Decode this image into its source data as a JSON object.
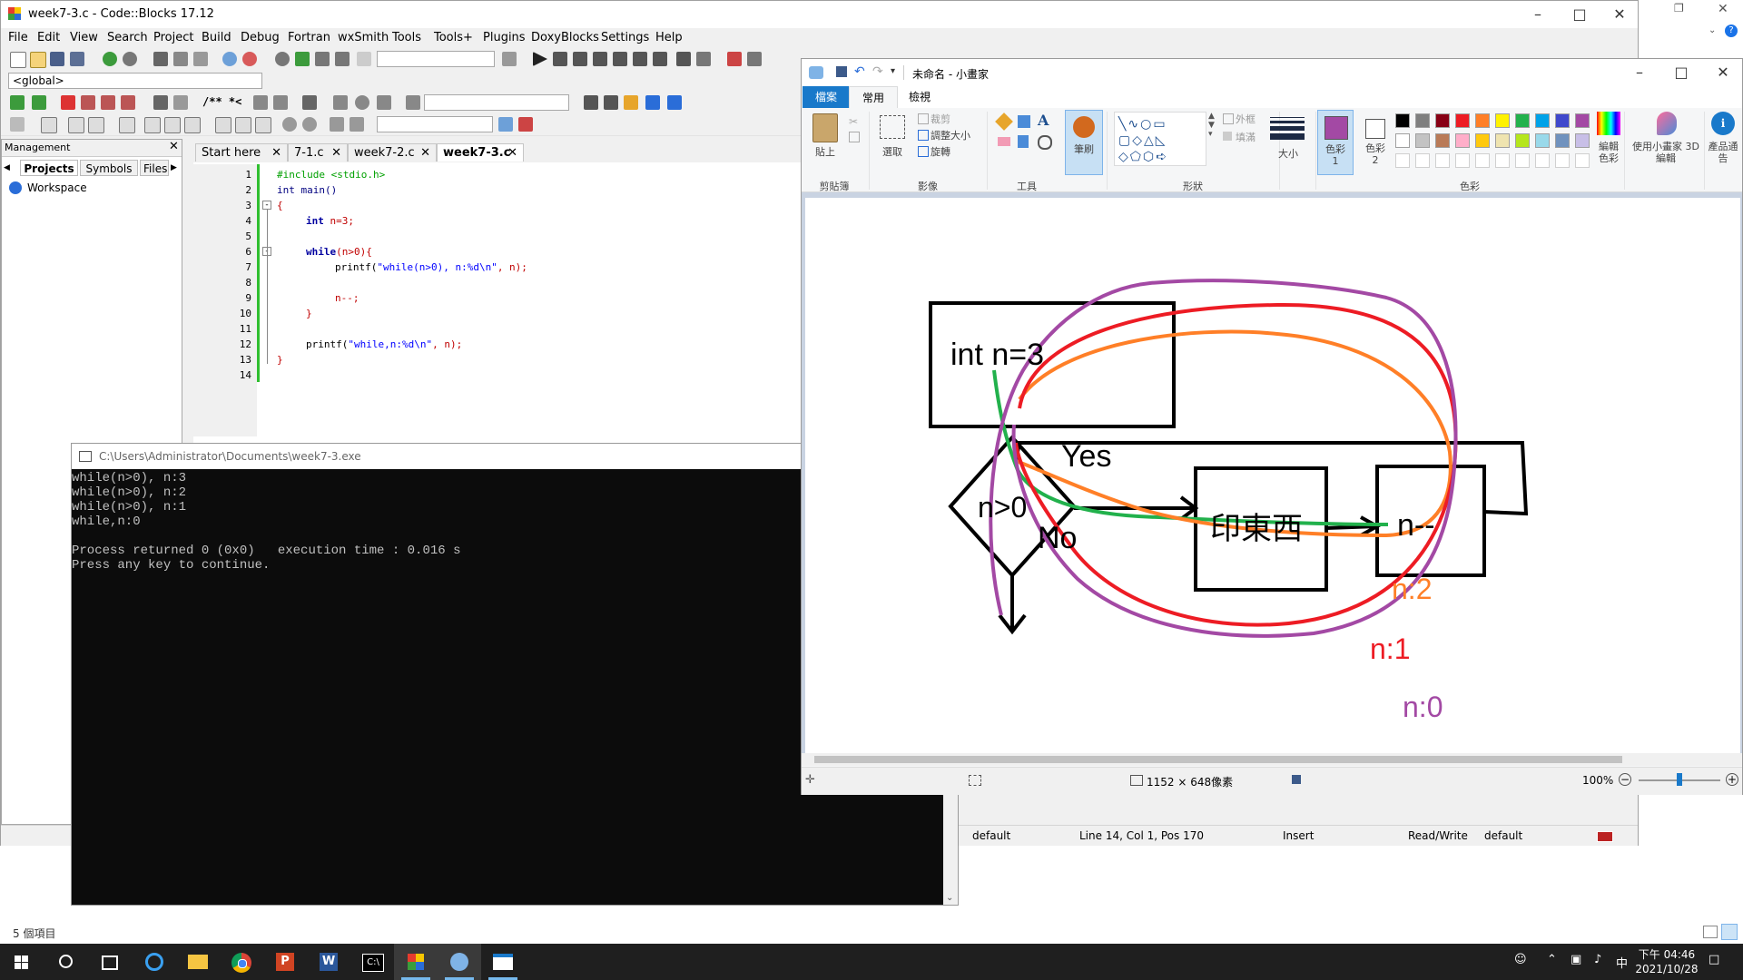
{
  "codeblocks": {
    "title": "week7-3.c - Code::Blocks 17.12",
    "menu": [
      "File",
      "Edit",
      "View",
      "Search",
      "Project",
      "Build",
      "Debug",
      "Fortran",
      "wxSmith",
      "Tools",
      "Tools+",
      "Plugins",
      "DoxyBlocks",
      "Settings",
      "Help"
    ],
    "scope_combo": "<global>",
    "doxy_comment": "/** *<",
    "management": {
      "title": "Management",
      "tabs": [
        "Projects",
        "Symbols",
        "Files"
      ],
      "tree_root": "Workspace"
    },
    "tabs": [
      "Start here",
      "7-1.c",
      "week7-2.c",
      "week7-3.c"
    ],
    "active_tab": "week7-3.c",
    "line_numbers": [
      "1",
      "2",
      "3",
      "4",
      "5",
      "6",
      "7",
      "8",
      "9",
      "10",
      "11",
      "12",
      "13",
      "14"
    ],
    "code": {
      "l1": "#include <stdio.h>",
      "l2": "int main()",
      "l3": "{",
      "l4_kw": "int",
      "l4_rest": " n=3;",
      "l6_kw": "while",
      "l6_rest": "(n>0){",
      "l7_fn": "printf(",
      "l7_str": "\"while(n>0), n:%d\\n\"",
      "l7_rest": ", n);",
      "l9": "n--;",
      "l10": "}",
      "l12_fn": "printf(",
      "l12_str": "\"while,n:%d\\n\"",
      "l12_rest": ", n);",
      "l13": "}"
    },
    "status": {
      "encoding": "default",
      "position": "Line 14, Col 1, Pos 170",
      "mode": "Insert",
      "access": "Read/Write",
      "profile": "default"
    }
  },
  "console": {
    "title": "C:\\Users\\Administrator\\Documents\\week7-3.exe",
    "lines": [
      "while(n>0), n:3",
      "while(n>0), n:2",
      "while(n>0), n:1",
      "while,n:0",
      "",
      "Process returned 0 (0x0)   execution time : 0.016 s",
      "Press any key to continue."
    ]
  },
  "paint": {
    "title": "未命名 - 小畫家",
    "tabs": [
      "檔案",
      "常用",
      "檢視"
    ],
    "ribbon": {
      "paste": "貼上",
      "select": "選取",
      "crop": "裁剪",
      "resize": "調整大小",
      "rotate": "旋轉",
      "brushes": "筆刷",
      "outline": "外框",
      "fill": "填滿",
      "size": "大小",
      "color1": "色彩 1",
      "color2": "色彩 2",
      "edit_colors": "編輯色彩",
      "paint3d": "使用小畫家 3D 編輯",
      "product_alert": "產品通告",
      "groups": [
        "剪貼簿",
        "影像",
        "工具",
        "形狀",
        "色彩"
      ]
    },
    "palette": [
      "#000000",
      "#7f7f7f",
      "#880015",
      "#ed1c24",
      "#ff7f27",
      "#fff200",
      "#22b14c",
      "#00a2e8",
      "#3f48cc",
      "#a349a4",
      "#ffffff",
      "#c3c3c3",
      "#b97a57",
      "#ffaec9",
      "#ffc90e",
      "#efe4b0",
      "#b5e61d",
      "#99d9ea",
      "#7092be",
      "#c8bfe7"
    ],
    "color1": "#a349a4",
    "canvas_text": {
      "box1": "int n=3",
      "diamond": "n>0",
      "yes": "Yes",
      "no": "No",
      "box2": "印東西",
      "box3": "n--",
      "n2": "n:2",
      "n1": "n:1",
      "n0": "n:0"
    },
    "stroke_colors": {
      "black": "#000000",
      "green": "#22b14c",
      "orange": "#ff7f27",
      "red": "#ed1c24",
      "purple": "#a349a4"
    },
    "status": {
      "dimensions": "1152 × 648像素",
      "zoom": "100%"
    }
  },
  "desktop": {
    "items_count": "5 個項目"
  },
  "taskbar": {
    "ime": "中",
    "time": "下午 04:46",
    "date": "2021/10/28"
  }
}
